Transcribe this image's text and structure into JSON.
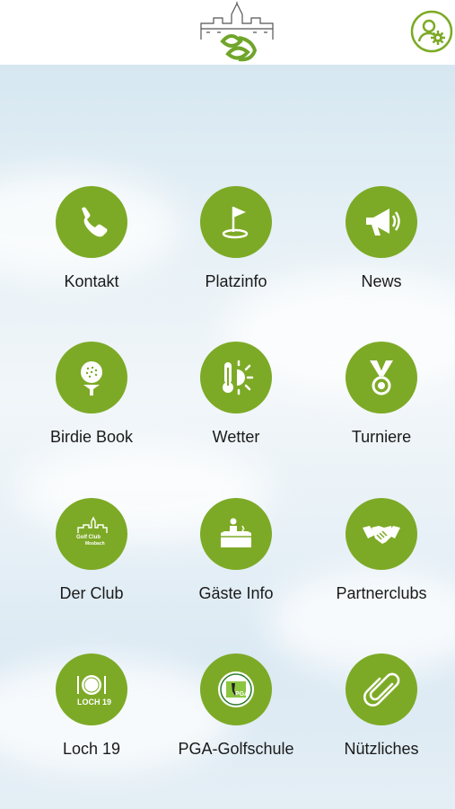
{
  "header": {
    "logo_icon": "golf-club-castle-logo",
    "settings_icon": "user-settings-icon"
  },
  "colors": {
    "accent": "#7daa26",
    "header_bg": "#ffffff",
    "label": "#1a1a1a"
  },
  "menu": [
    {
      "label": "Kontakt",
      "icon": "phone-icon"
    },
    {
      "label": "Platzinfo",
      "icon": "golf-flag-icon"
    },
    {
      "label": "News",
      "icon": "megaphone-icon"
    },
    {
      "label": "Birdie Book",
      "icon": "golf-ball-tee-icon"
    },
    {
      "label": "Wetter",
      "icon": "thermometer-sun-icon"
    },
    {
      "label": "Turniere",
      "icon": "medal-icon"
    },
    {
      "label": "Der Club",
      "icon": "club-logo-icon"
    },
    {
      "label": "Gäste Info",
      "icon": "reception-desk-icon"
    },
    {
      "label": "Partnerclubs",
      "icon": "handshake-icon"
    },
    {
      "label": "Loch 19",
      "icon": "restaurant-plate-icon"
    },
    {
      "label": "PGA-Golfschule",
      "icon": "pga-logo-icon"
    },
    {
      "label": "Nützliches",
      "icon": "paperclip-icon"
    }
  ],
  "loch19_badge": "LOCH 19",
  "pga_badge": "PGA",
  "club_badge_line1": "Golf Club",
  "club_badge_line2": "Mosbach"
}
